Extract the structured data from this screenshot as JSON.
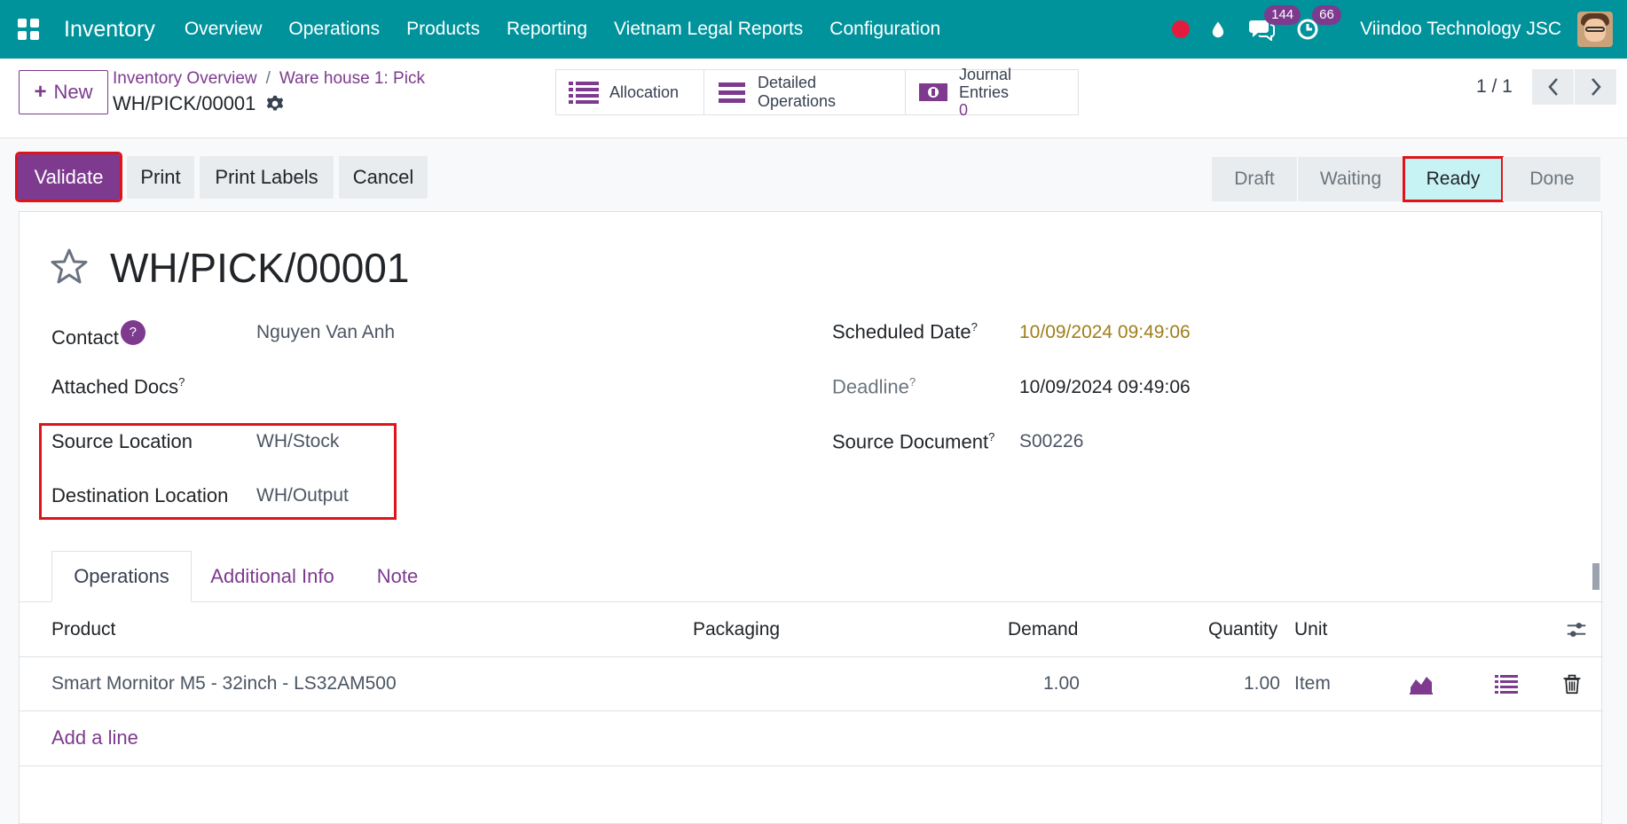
{
  "navbar": {
    "app_name": "Inventory",
    "menu": [
      "Overview",
      "Operations",
      "Products",
      "Reporting",
      "Vietnam Legal Reports",
      "Configuration"
    ],
    "messages_count": "144",
    "activities_count": "66",
    "company": "Viindoo Technology JSC"
  },
  "control_panel": {
    "new_label": "New",
    "breadcrumb": [
      "Inventory Overview",
      "Ware house 1: Pick"
    ],
    "record_name": "WH/PICK/00001",
    "smart_buttons": {
      "allocation": "Allocation",
      "detailed_operations": "Detailed Operations",
      "journal_entries": "Journal Entries",
      "journal_entries_count": "0"
    },
    "pager": "1 / 1"
  },
  "actions": {
    "validate": "Validate",
    "print": "Print",
    "print_labels": "Print Labels",
    "cancel": "Cancel"
  },
  "statusbar": {
    "stages": [
      "Draft",
      "Waiting",
      "Ready",
      "Done"
    ],
    "current": "Ready"
  },
  "form": {
    "title": "WH/PICK/00001",
    "help_mark": "?",
    "contact_label": "Contact",
    "contact_value": "Nguyen Van Anh",
    "attached_docs_label": "Attached Docs",
    "source_location_label": "Source Location",
    "source_location_value": "WH/Stock",
    "destination_location_label": "Destination Location",
    "destination_location_value": "WH/Output",
    "scheduled_date_label": "Scheduled Date",
    "scheduled_date_value": "10/09/2024 09:49:06",
    "deadline_label": "Deadline",
    "deadline_value": "10/09/2024 09:49:06",
    "source_document_label": "Source Document",
    "source_document_value": "S00226",
    "tooltip_mark": "?"
  },
  "tabs": [
    "Operations",
    "Additional Info",
    "Note"
  ],
  "table": {
    "columns": [
      "Product",
      "Packaging",
      "Demand",
      "Quantity",
      "Unit"
    ],
    "rows": [
      {
        "product": "Smart Mornitor M5 - 32inch - LS32AM500",
        "packaging": "",
        "demand": "1.00",
        "quantity": "1.00",
        "unit": "Item"
      }
    ],
    "add_line": "Add a line"
  },
  "colors": {
    "navbar": "#01939b",
    "primary": "#7d3a8e",
    "highlight": "#e0131a",
    "current_stage": "#c8f3f5"
  }
}
